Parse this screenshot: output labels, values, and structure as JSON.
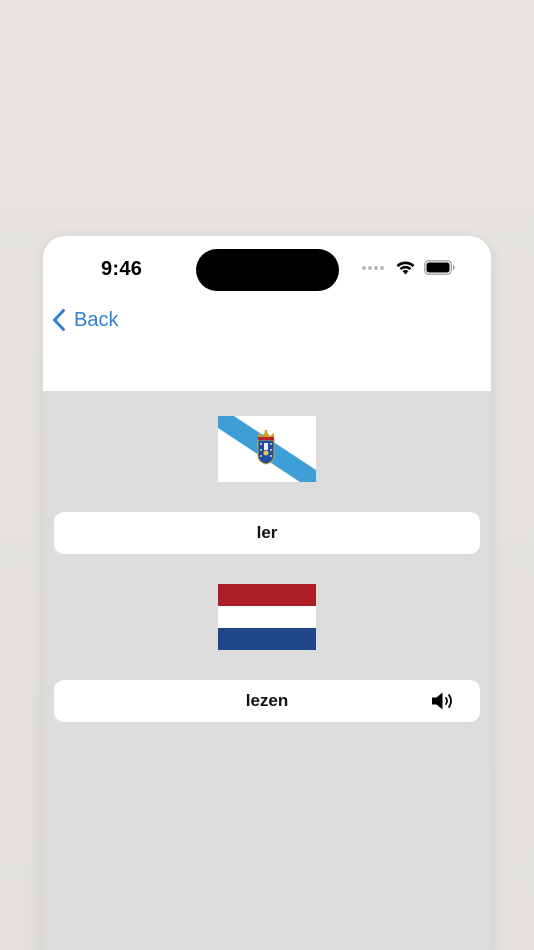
{
  "status_bar": {
    "time": "9:46",
    "icons": [
      "signal-dots-icon",
      "wifi-icon",
      "battery-icon"
    ]
  },
  "nav": {
    "back_label": "Back",
    "back_icon": "chevron-left-icon",
    "accent_color": "#2f7fd6"
  },
  "source": {
    "flag_icon": "galicia-flag-icon",
    "word": "ler"
  },
  "target": {
    "flag_icon": "netherlands-flag-icon",
    "word": "lezen",
    "audio_icon": "speaker-icon"
  }
}
